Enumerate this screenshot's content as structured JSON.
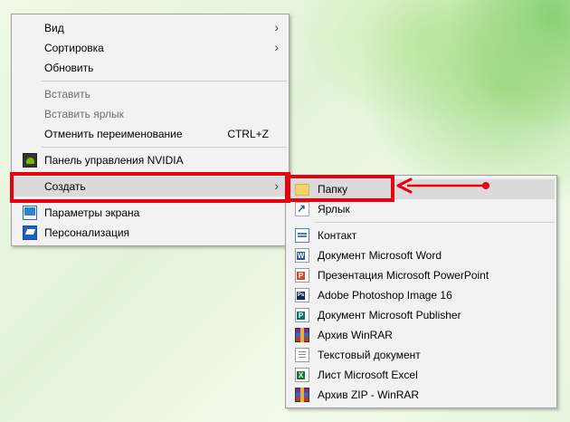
{
  "main_menu": {
    "items": [
      {
        "label": "Вид",
        "arrow": "›"
      },
      {
        "label": "Сортировка",
        "arrow": "›"
      },
      {
        "label": "Обновить"
      },
      {
        "label": "Вставить"
      },
      {
        "label": "Вставить ярлык"
      },
      {
        "label": "Отменить переименование",
        "shortcut": "CTRL+Z"
      },
      {
        "label": "Панель управления NVIDIA",
        "icon": "nvidia-icon"
      },
      {
        "label": "Создать",
        "arrow": "›"
      },
      {
        "label": "Параметры экрана",
        "icon": "display-icon"
      },
      {
        "label": "Персонализация",
        "icon": "personalization-icon"
      }
    ]
  },
  "sub_menu": {
    "items": [
      {
        "label": "Папку",
        "icon": "folder-icon",
        "highlighted": true
      },
      {
        "label": "Ярлык",
        "icon": "shortcut-icon"
      },
      {
        "label": "Контакт",
        "icon": "contact-icon"
      },
      {
        "label": "Документ Microsoft Word",
        "icon": "word-icon",
        "letter": "W"
      },
      {
        "label": "Презентация Microsoft PowerPoint",
        "icon": "powerpoint-icon",
        "letter": "P"
      },
      {
        "label": "Adobe Photoshop Image 16",
        "icon": "photoshop-icon",
        "letter": "Ps"
      },
      {
        "label": "Документ Microsoft Publisher",
        "icon": "publisher-icon",
        "letter": "P"
      },
      {
        "label": "Архив WinRAR",
        "icon": "winrar-icon"
      },
      {
        "label": "Текстовый документ",
        "icon": "text-document-icon"
      },
      {
        "label": "Лист Microsoft Excel",
        "icon": "excel-icon",
        "letter": "X"
      },
      {
        "label": "Архив ZIP - WinRAR",
        "icon": "winrar-zip-icon"
      }
    ]
  },
  "colors": {
    "annotation_red": "#e8000e",
    "menu_bg": "#f2f2f2",
    "highlight_bg": "#dadada",
    "word": "#2b5797",
    "powerpoint": "#d24726",
    "photoshop": "#0b2a5a",
    "publisher": "#077568",
    "excel": "#1e7145"
  }
}
